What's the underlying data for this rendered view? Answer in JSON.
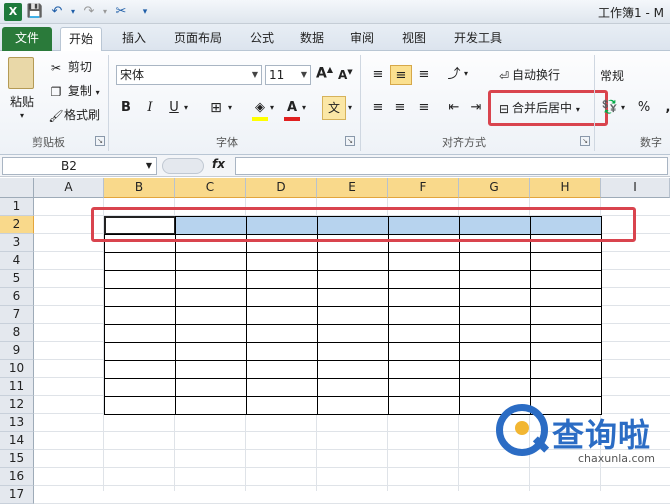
{
  "window": {
    "title": "工作簿1 - M"
  },
  "tabs": [
    {
      "label": "文件"
    },
    {
      "label": "开始"
    },
    {
      "label": "插入"
    },
    {
      "label": "页面布局"
    },
    {
      "label": "公式"
    },
    {
      "label": "数据"
    },
    {
      "label": "审阅"
    },
    {
      "label": "视图"
    },
    {
      "label": "开发工具"
    }
  ],
  "clipboard": {
    "paste": "粘贴",
    "cut": "剪切",
    "copy": "复制",
    "format_painter": "格式刷",
    "label": "剪贴板"
  },
  "font": {
    "family": "宋体",
    "size": "11",
    "label": "字体",
    "bold": "B",
    "italic": "I",
    "underline": "U",
    "grow": "A",
    "shrink": "A",
    "color_letter": "A",
    "phonetic": "文"
  },
  "alignment": {
    "wrap_text": "自动换行",
    "merge_center": "合并后居中",
    "label": "对齐方式"
  },
  "number": {
    "format": "常规",
    "percent": "%",
    "comma": ",",
    "label": "数字"
  },
  "formula_bar": {
    "name_box": "B2",
    "fx": "fx"
  },
  "columns": [
    "A",
    "B",
    "C",
    "D",
    "E",
    "F",
    "G",
    "H",
    "I"
  ],
  "rows": [
    "1",
    "2",
    "3",
    "4",
    "5",
    "6",
    "7",
    "8",
    "9",
    "10",
    "11",
    "12",
    "13",
    "14",
    "15",
    "16",
    "17"
  ],
  "watermark": {
    "title": "查询啦",
    "url": "chaxunla.com"
  },
  "colors": {
    "file_tab": "#2a7a3a",
    "selection_fill": "#b7d3ee",
    "header_selected": "#f9d98b",
    "highlight_red": "#d9444e",
    "brand_blue": "#2b6cc4"
  }
}
